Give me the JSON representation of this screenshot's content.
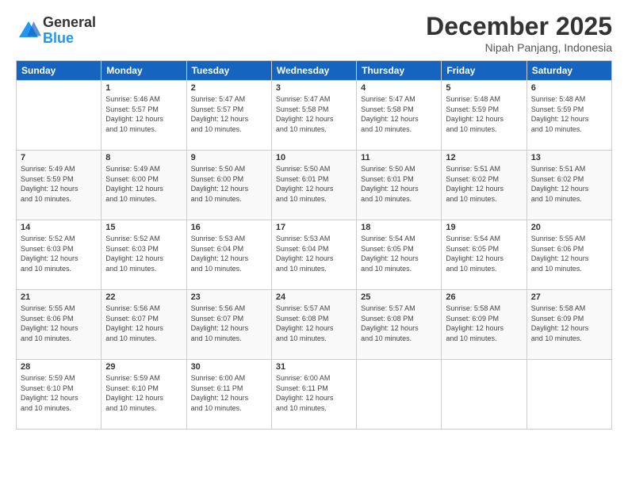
{
  "logo": {
    "general": "General",
    "blue": "Blue"
  },
  "title": "December 2025",
  "subtitle": "Nipah Panjang, Indonesia",
  "weekdays": [
    "Sunday",
    "Monday",
    "Tuesday",
    "Wednesday",
    "Thursday",
    "Friday",
    "Saturday"
  ],
  "weeks": [
    [
      {
        "day": "",
        "info": ""
      },
      {
        "day": "1",
        "info": "Sunrise: 5:46 AM\nSunset: 5:57 PM\nDaylight: 12 hours\nand 10 minutes."
      },
      {
        "day": "2",
        "info": "Sunrise: 5:47 AM\nSunset: 5:57 PM\nDaylight: 12 hours\nand 10 minutes."
      },
      {
        "day": "3",
        "info": "Sunrise: 5:47 AM\nSunset: 5:58 PM\nDaylight: 12 hours\nand 10 minutes."
      },
      {
        "day": "4",
        "info": "Sunrise: 5:47 AM\nSunset: 5:58 PM\nDaylight: 12 hours\nand 10 minutes."
      },
      {
        "day": "5",
        "info": "Sunrise: 5:48 AM\nSunset: 5:59 PM\nDaylight: 12 hours\nand 10 minutes."
      },
      {
        "day": "6",
        "info": "Sunrise: 5:48 AM\nSunset: 5:59 PM\nDaylight: 12 hours\nand 10 minutes."
      }
    ],
    [
      {
        "day": "7",
        "info": "Sunrise: 5:49 AM\nSunset: 5:59 PM\nDaylight: 12 hours\nand 10 minutes."
      },
      {
        "day": "8",
        "info": "Sunrise: 5:49 AM\nSunset: 6:00 PM\nDaylight: 12 hours\nand 10 minutes."
      },
      {
        "day": "9",
        "info": "Sunrise: 5:50 AM\nSunset: 6:00 PM\nDaylight: 12 hours\nand 10 minutes."
      },
      {
        "day": "10",
        "info": "Sunrise: 5:50 AM\nSunset: 6:01 PM\nDaylight: 12 hours\nand 10 minutes."
      },
      {
        "day": "11",
        "info": "Sunrise: 5:50 AM\nSunset: 6:01 PM\nDaylight: 12 hours\nand 10 minutes."
      },
      {
        "day": "12",
        "info": "Sunrise: 5:51 AM\nSunset: 6:02 PM\nDaylight: 12 hours\nand 10 minutes."
      },
      {
        "day": "13",
        "info": "Sunrise: 5:51 AM\nSunset: 6:02 PM\nDaylight: 12 hours\nand 10 minutes."
      }
    ],
    [
      {
        "day": "14",
        "info": "Sunrise: 5:52 AM\nSunset: 6:03 PM\nDaylight: 12 hours\nand 10 minutes."
      },
      {
        "day": "15",
        "info": "Sunrise: 5:52 AM\nSunset: 6:03 PM\nDaylight: 12 hours\nand 10 minutes."
      },
      {
        "day": "16",
        "info": "Sunrise: 5:53 AM\nSunset: 6:04 PM\nDaylight: 12 hours\nand 10 minutes."
      },
      {
        "day": "17",
        "info": "Sunrise: 5:53 AM\nSunset: 6:04 PM\nDaylight: 12 hours\nand 10 minutes."
      },
      {
        "day": "18",
        "info": "Sunrise: 5:54 AM\nSunset: 6:05 PM\nDaylight: 12 hours\nand 10 minutes."
      },
      {
        "day": "19",
        "info": "Sunrise: 5:54 AM\nSunset: 6:05 PM\nDaylight: 12 hours\nand 10 minutes."
      },
      {
        "day": "20",
        "info": "Sunrise: 5:55 AM\nSunset: 6:06 PM\nDaylight: 12 hours\nand 10 minutes."
      }
    ],
    [
      {
        "day": "21",
        "info": "Sunrise: 5:55 AM\nSunset: 6:06 PM\nDaylight: 12 hours\nand 10 minutes."
      },
      {
        "day": "22",
        "info": "Sunrise: 5:56 AM\nSunset: 6:07 PM\nDaylight: 12 hours\nand 10 minutes."
      },
      {
        "day": "23",
        "info": "Sunrise: 5:56 AM\nSunset: 6:07 PM\nDaylight: 12 hours\nand 10 minutes."
      },
      {
        "day": "24",
        "info": "Sunrise: 5:57 AM\nSunset: 6:08 PM\nDaylight: 12 hours\nand 10 minutes."
      },
      {
        "day": "25",
        "info": "Sunrise: 5:57 AM\nSunset: 6:08 PM\nDaylight: 12 hours\nand 10 minutes."
      },
      {
        "day": "26",
        "info": "Sunrise: 5:58 AM\nSunset: 6:09 PM\nDaylight: 12 hours\nand 10 minutes."
      },
      {
        "day": "27",
        "info": "Sunrise: 5:58 AM\nSunset: 6:09 PM\nDaylight: 12 hours\nand 10 minutes."
      }
    ],
    [
      {
        "day": "28",
        "info": "Sunrise: 5:59 AM\nSunset: 6:10 PM\nDaylight: 12 hours\nand 10 minutes."
      },
      {
        "day": "29",
        "info": "Sunrise: 5:59 AM\nSunset: 6:10 PM\nDaylight: 12 hours\nand 10 minutes."
      },
      {
        "day": "30",
        "info": "Sunrise: 6:00 AM\nSunset: 6:11 PM\nDaylight: 12 hours\nand 10 minutes."
      },
      {
        "day": "31",
        "info": "Sunrise: 6:00 AM\nSunset: 6:11 PM\nDaylight: 12 hours\nand 10 minutes."
      },
      {
        "day": "",
        "info": ""
      },
      {
        "day": "",
        "info": ""
      },
      {
        "day": "",
        "info": ""
      }
    ]
  ]
}
